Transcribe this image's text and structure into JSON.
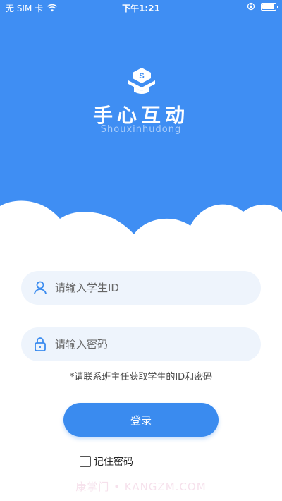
{
  "status_bar": {
    "carrier": "无 SIM 卡",
    "time": "下午1:21",
    "wifi_icon": "wifi-icon",
    "lock_icon": "orientation-lock-icon",
    "battery_icon": "battery-icon",
    "battery_level": 0.95
  },
  "app": {
    "name": "手心互动",
    "subtitle": "Shouxinhudong",
    "logo_icon": "graduation-cap-s-icon",
    "brand_color": "#3f8ef3"
  },
  "form": {
    "student_id": {
      "placeholder": "请输入学生ID",
      "value": "",
      "icon": "user-icon"
    },
    "password": {
      "placeholder": "请输入密码",
      "value": "",
      "icon": "lock-icon"
    },
    "hint": "*请联系班主任获取学生的ID和密码",
    "login_label": "登录",
    "remember_label": "记住密码",
    "remember_checked": false
  },
  "watermark": "康掌门 • KANGZM.COM"
}
